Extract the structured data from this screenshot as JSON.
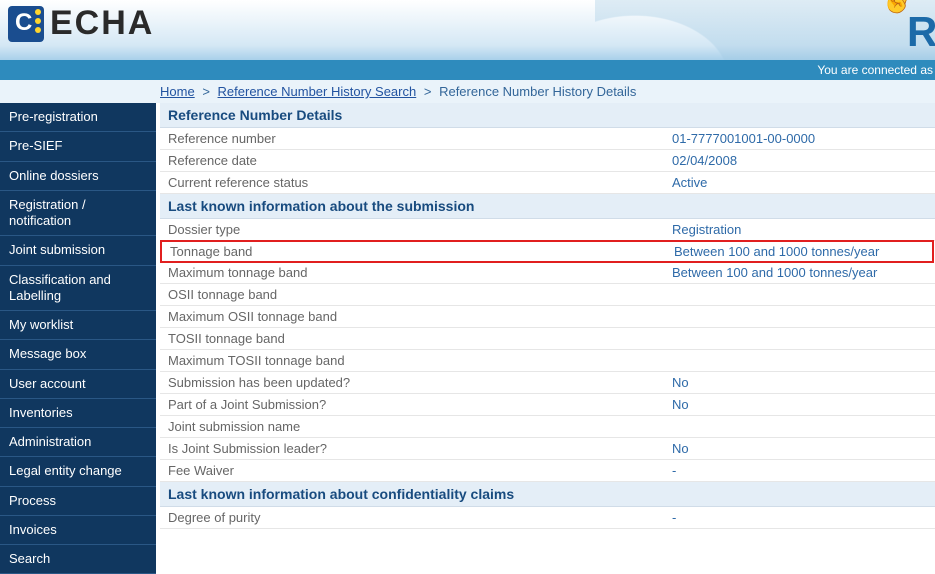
{
  "header": {
    "logo_text": "ECHA",
    "right_letter": "R",
    "status_text": "You are connected as"
  },
  "breadcrumb": {
    "home": "Home",
    "search": "Reference Number History Search",
    "current": "Reference Number History Details",
    "sep": ">"
  },
  "sidebar": {
    "items": [
      "Pre-registration",
      "Pre-SIEF",
      "Online dossiers",
      "Registration / notification",
      "Joint submission",
      "Classification and Labelling",
      "My worklist",
      "Message box",
      "User account",
      "Inventories",
      "Administration",
      "Legal entity change",
      "Process",
      "Invoices",
      "Search"
    ]
  },
  "sections": {
    "ref_details_title": "Reference Number Details",
    "submission_title": "Last known information about the submission",
    "confidentiality_title": "Last known information about confidentiality claims"
  },
  "ref_details": [
    {
      "label": "Reference number",
      "value": "01-7777001001-00-0000"
    },
    {
      "label": "Reference date",
      "value": "02/04/2008"
    },
    {
      "label": "Current reference status",
      "value": "Active"
    }
  ],
  "submission": [
    {
      "label": "Dossier type",
      "value": "Registration",
      "hl": false
    },
    {
      "label": "Tonnage band",
      "value": "Between 100 and 1000 tonnes/year",
      "hl": true
    },
    {
      "label": "Maximum tonnage band",
      "value": "Between 100 and 1000 tonnes/year",
      "hl": false
    },
    {
      "label": "OSII tonnage band",
      "value": "",
      "hl": false
    },
    {
      "label": "Maximum OSII tonnage band",
      "value": "",
      "hl": false
    },
    {
      "label": "TOSII tonnage band",
      "value": "",
      "hl": false
    },
    {
      "label": "Maximum TOSII tonnage band",
      "value": "",
      "hl": false
    },
    {
      "label": "Submission has been updated?",
      "value": "No",
      "hl": false
    },
    {
      "label": "Part of a Joint Submission?",
      "value": "No",
      "hl": false
    },
    {
      "label": "Joint submission name",
      "value": "",
      "hl": false
    },
    {
      "label": "Is Joint Submission leader?",
      "value": "No",
      "hl": false
    },
    {
      "label": "Fee Waiver",
      "value": "-",
      "hl": false
    }
  ],
  "confidentiality": [
    {
      "label": "Degree of purity",
      "value": "-"
    }
  ]
}
